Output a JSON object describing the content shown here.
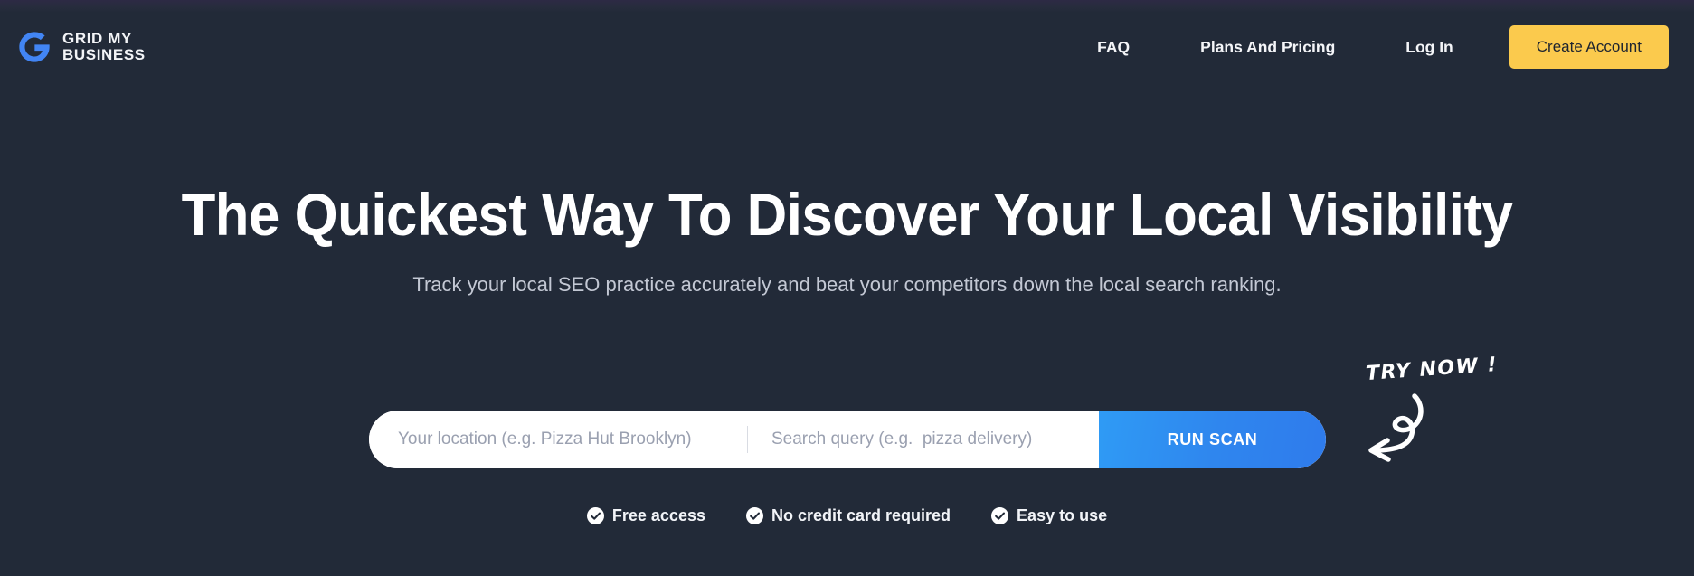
{
  "brand": {
    "logo_icon": "google-g-icon",
    "line1": "GRID MY",
    "line2": "BUSINESS"
  },
  "nav": {
    "links": [
      {
        "label": "FAQ",
        "name": "nav-link-faq"
      },
      {
        "label": "Plans And Pricing",
        "name": "nav-link-plans-and-pricing"
      },
      {
        "label": "Log In",
        "name": "nav-link-log-in"
      }
    ],
    "cta_label": "Create Account",
    "cta_color": "#fbca4d"
  },
  "hero": {
    "title": "The Quickest Way To Discover Your Local Visibility",
    "subtitle": "Track your local SEO practice accurately and beat your competitors down the local search ranking."
  },
  "search": {
    "location_placeholder": "Your location (e.g. Pizza Hut Brooklyn)",
    "location_value": "",
    "query_placeholder": "Search query (e.g.  pizza delivery)",
    "query_value": "",
    "scan_button_label": "RUN SCAN",
    "scan_button_color": "#2f86ee"
  },
  "annotation": {
    "text": "TRY NOW !",
    "arrow_icon": "curved-arrow-left-icon"
  },
  "features": [
    {
      "label": "Free access",
      "icon": "check-circle-icon"
    },
    {
      "label": "No credit card required",
      "icon": "check-circle-icon"
    },
    {
      "label": "Easy to use",
      "icon": "check-circle-icon"
    }
  ],
  "theme": {
    "background": "#222a38",
    "accent_blue": "#2f86ee",
    "accent_yellow": "#fbca4d",
    "logo_blue": "#4285f4"
  }
}
